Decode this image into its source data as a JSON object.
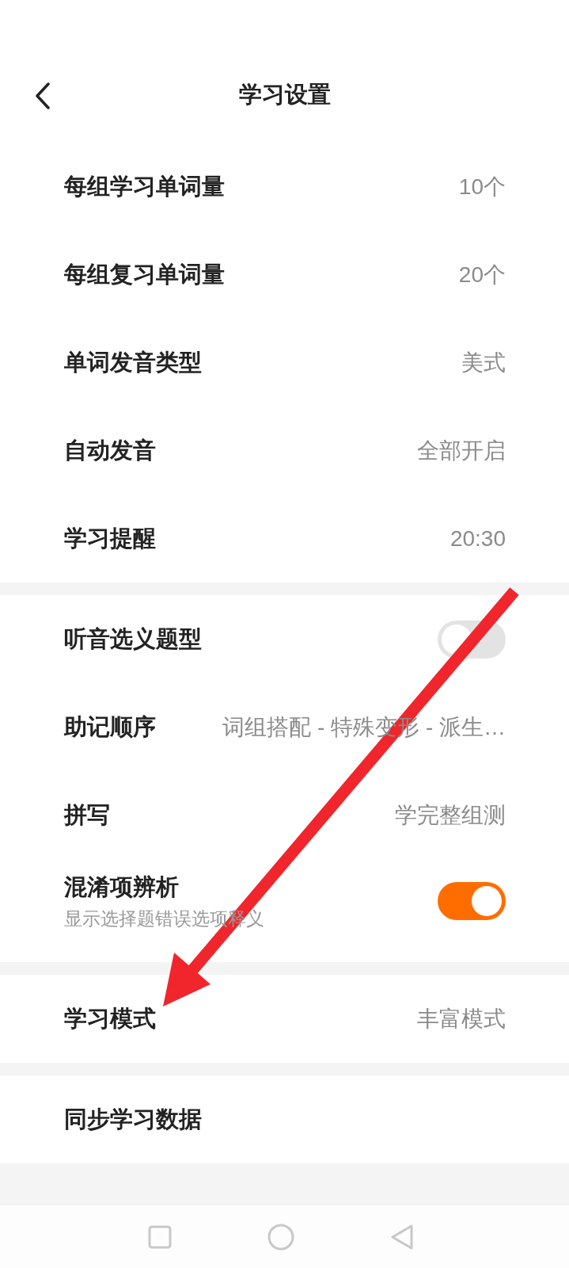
{
  "header": {
    "title": "学习设置"
  },
  "groups": [
    {
      "rows": [
        {
          "kind": "value",
          "label": "每组学习单词量",
          "value": "10个"
        },
        {
          "kind": "value",
          "label": "每组复习单词量",
          "value": "20个"
        },
        {
          "kind": "value",
          "label": "单词发音类型",
          "value": "美式"
        },
        {
          "kind": "value",
          "label": "自动发音",
          "value": "全部开启"
        },
        {
          "kind": "value",
          "label": "学习提醒",
          "value": "20:30"
        }
      ]
    },
    {
      "rows": [
        {
          "kind": "toggle",
          "label": "听音选义题型",
          "on": false
        },
        {
          "kind": "value",
          "label": "助记顺序",
          "value": "词组搭配 - 特殊变形 - 派生…"
        },
        {
          "kind": "value",
          "label": "拼写",
          "value": "学完整组测"
        },
        {
          "kind": "toggle",
          "label": "混淆项辨析",
          "subtitle": "显示选择题错误选项释义",
          "on": true
        }
      ]
    },
    {
      "rows": [
        {
          "kind": "value",
          "label": "学习模式",
          "value": "丰富模式"
        }
      ]
    },
    {
      "rows": [
        {
          "kind": "link",
          "label": "同步学习数据"
        }
      ]
    }
  ]
}
